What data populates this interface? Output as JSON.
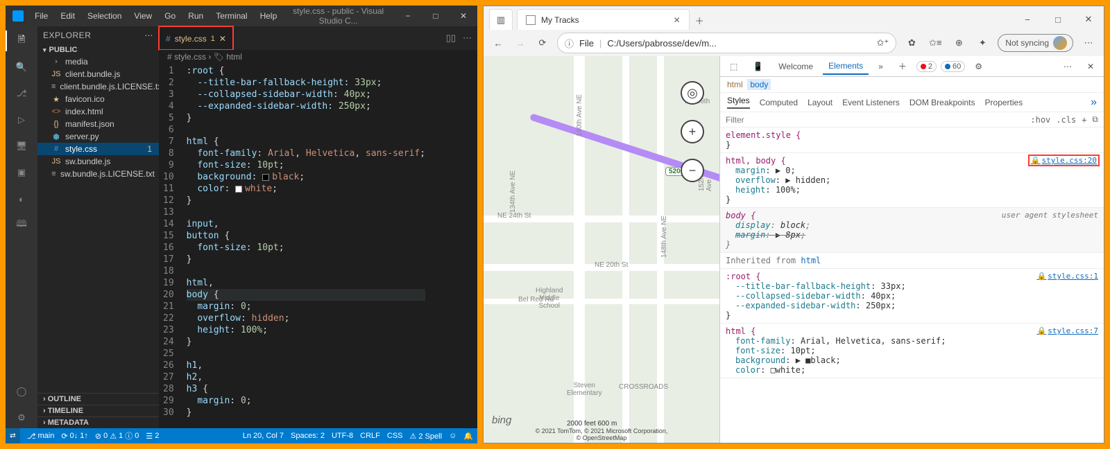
{
  "vscode": {
    "menus": [
      "File",
      "Edit",
      "Selection",
      "View",
      "Go",
      "Run",
      "Terminal",
      "Help"
    ],
    "title": "style.css - public - Visual Studio C...",
    "explorer": {
      "title": "EXPLORER",
      "rootName": "PUBLIC",
      "items": [
        {
          "icon": "›",
          "label": "media",
          "type": "folder"
        },
        {
          "icon": "JS",
          "iconColor": "#e2c08d",
          "label": "client.bundle.js"
        },
        {
          "icon": "≡",
          "label": "client.bundle.js.LICENSE.txt"
        },
        {
          "icon": "★",
          "iconColor": "#e2c08d",
          "label": "favicon.ico"
        },
        {
          "icon": "<>",
          "iconColor": "#e37933",
          "label": "index.html"
        },
        {
          "icon": "{}",
          "iconColor": "#e2c08d",
          "label": "manifest.json"
        },
        {
          "icon": "⬢",
          "iconColor": "#519aba",
          "label": "server.py"
        },
        {
          "icon": "#",
          "iconColor": "#519aba",
          "label": "style.css",
          "sel": true,
          "badge": "1"
        },
        {
          "icon": "JS",
          "iconColor": "#e2c08d",
          "label": "sw.bundle.js"
        },
        {
          "icon": "≡",
          "label": "sw.bundle.js.LICENSE.txt"
        }
      ],
      "collapsed": [
        "OUTLINE",
        "TIMELINE",
        "METADATA"
      ]
    },
    "tab": {
      "name": "style.css",
      "badge": "1"
    },
    "breadcrumb": "# style.css › 🏷 html",
    "code_lines": [
      {
        "n": 1,
        "html": "<span class='sel'>:root</span> <span class='pun'>{</span>"
      },
      {
        "n": 2,
        "html": "  <span class='prop'>--title-bar-fallback-height</span>: <span class='num'>33px</span>;"
      },
      {
        "n": 3,
        "html": "  <span class='prop'>--collapsed-sidebar-width</span>: <span class='num'>40px</span>;"
      },
      {
        "n": 4,
        "html": "  <span class='prop'>--expanded-sidebar-width</span>: <span class='num'>250px</span>;"
      },
      {
        "n": 5,
        "html": "<span class='pun'>}</span>"
      },
      {
        "n": 6,
        "html": ""
      },
      {
        "n": 7,
        "html": "<span class='sel'>html</span> <span class='pun'>{</span>"
      },
      {
        "n": 8,
        "html": "  <span class='prop'>font-family</span>: <span class='val'>Arial</span>, <span class='val'>Helvetica</span>, <span class='val'>sans-serif</span>;"
      },
      {
        "n": 9,
        "html": "  <span class='prop'>font-size</span>: <span class='num'>10pt</span>;"
      },
      {
        "n": 10,
        "html": "  <span class='prop'>background</span>: <span class='swatch sw-black'></span><span class='val'>black</span>;"
      },
      {
        "n": 11,
        "html": "  <span class='prop'>color</span>: <span class='swatch sw-white'></span><span class='val'>white</span>;"
      },
      {
        "n": 12,
        "html": "<span class='pun'>}</span>"
      },
      {
        "n": 13,
        "html": ""
      },
      {
        "n": 14,
        "html": "<span class='sel'>input</span>,"
      },
      {
        "n": 15,
        "html": "<span class='sel'>button</span> <span class='pun'>{</span>"
      },
      {
        "n": 16,
        "html": "  <span class='prop'>font-size</span>: <span class='num'>10pt</span>;"
      },
      {
        "n": 17,
        "html": "<span class='pun'>}</span>"
      },
      {
        "n": 18,
        "html": ""
      },
      {
        "n": 19,
        "html": "<span class='sel'>html</span>,"
      },
      {
        "n": 20,
        "html": "<span class='sel'>body</span> <span class='pun'>{</span>",
        "cur": true
      },
      {
        "n": 21,
        "html": "  <span class='prop'>margin</span>: <span class='num'>0</span>;"
      },
      {
        "n": 22,
        "html": "  <span class='prop'>overflow</span>: <span class='val'>hidden</span>;"
      },
      {
        "n": 23,
        "html": "  <span class='prop'>height</span>: <span class='num'>100%</span>;"
      },
      {
        "n": 24,
        "html": "<span class='pun'>}</span>"
      },
      {
        "n": 25,
        "html": ""
      },
      {
        "n": 26,
        "html": "<span class='sel'>h1</span>,"
      },
      {
        "n": 27,
        "html": "<span class='sel'>h2</span>,"
      },
      {
        "n": 28,
        "html": "<span class='sel'>h3</span> <span class='pun'>{</span>"
      },
      {
        "n": 29,
        "html": "  <span class='prop'>margin</span>: <span class='num'>0</span>;"
      },
      {
        "n": 30,
        "html": "<span class='pun'>}</span>"
      }
    ],
    "status": {
      "branch": "main",
      "sync": "0↓ 1↑",
      "errs": "0",
      "warns": "1",
      "infos": "0",
      "sel": "2",
      "pos": "Ln 20, Col 7",
      "spaces": "Spaces: 2",
      "enc": "UTF-8",
      "eol": "CRLF",
      "lang": "CSS",
      "spell": "⚠ 2 Spell"
    }
  },
  "browser": {
    "tabTitle": "My Tracks",
    "url": {
      "scheme": "File",
      "path": "C:/Users/pabrosse/dev/m..."
    },
    "profile": "Not syncing",
    "map": {
      "labels": [
        "NE 36th",
        "NE 24th St",
        "NE 20th St",
        "Bel Red Rd",
        "134th Ave NE",
        "140th Ave NE",
        "148th Ave NE",
        "152nd Ave",
        "Steven Elementary",
        "CROSSROADS",
        "Highland Middle School"
      ],
      "highway": "520",
      "scale": "2000 feet       600 m",
      "logo": "bing",
      "attr1": "© 2021 TomTom, © 2021 Microsoft Corporation,",
      "attr2": "© OpenStreetMap"
    },
    "devtools": {
      "top_tabs": [
        "Welcome",
        "Elements"
      ],
      "err_count": "2",
      "info_count": "60",
      "crumb": [
        "html",
        "body"
      ],
      "panels": [
        "Styles",
        "Computed",
        "Layout",
        "Event Listeners",
        "DOM Breakpoints",
        "Properties"
      ],
      "filter_placeholder": "Filter",
      "filter_btns": [
        ":hov",
        ".cls",
        "+",
        "⧉"
      ],
      "rules": [
        {
          "sel": "element.style {",
          "props": [],
          "close": "}"
        },
        {
          "sel": "html, body {",
          "src": "style.css:20",
          "hl": true,
          "props": [
            {
              "n": "margin",
              "v": "▶ 0"
            },
            {
              "n": "overflow",
              "v": "▶ hidden"
            },
            {
              "n": "height",
              "v": "100%"
            }
          ],
          "close": "}"
        },
        {
          "sel": "body {",
          "ua": true,
          "uaLabel": "user agent stylesheet",
          "props": [
            {
              "n": "display",
              "v": "block"
            },
            {
              "n": "margin",
              "v": "▶ 8px",
              "strike": true
            }
          ],
          "close": "}"
        }
      ],
      "inherit": "Inherited from ",
      "inherit_el": "html",
      "rules2": [
        {
          "sel": ":root {",
          "src": "style.css:1",
          "props": [
            {
              "n": "--title-bar-fallback-height",
              "v": "33px"
            },
            {
              "n": "--collapsed-sidebar-width",
              "v": "40px"
            },
            {
              "n": "--expanded-sidebar-width",
              "v": "250px"
            }
          ],
          "close": "}"
        },
        {
          "sel": "html {",
          "src": "style.css:7",
          "props": [
            {
              "n": "font-family",
              "v": "Arial, Helvetica, sans-serif"
            },
            {
              "n": "font-size",
              "v": "10pt"
            },
            {
              "n": "background",
              "v": "▶ ■black",
              "swatch": "black"
            },
            {
              "n": "color",
              "v": "□white",
              "swatch": "white",
              "cut": true
            }
          ],
          "close": ""
        }
      ]
    }
  }
}
